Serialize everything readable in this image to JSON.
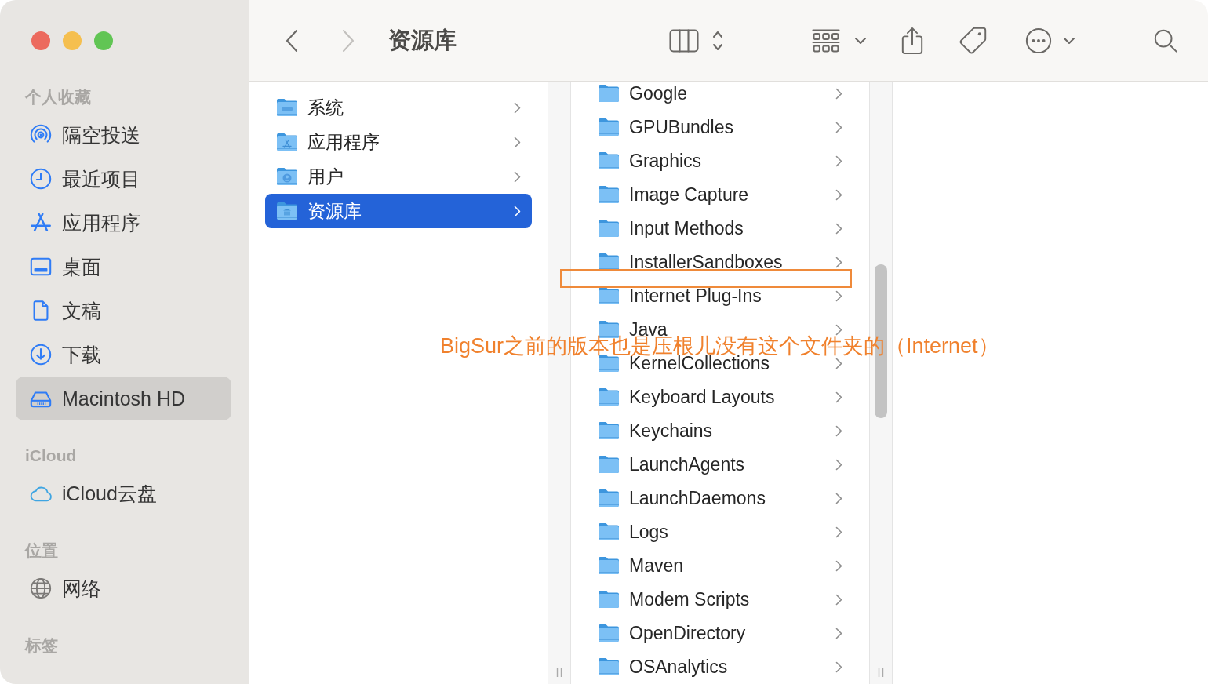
{
  "window": {
    "title": "资源库"
  },
  "toolbar": {
    "back": {
      "disabled": false
    },
    "forward": {
      "disabled": true
    }
  },
  "sidebar": {
    "sections": [
      {
        "heading": "个人收藏",
        "items": [
          {
            "label": "隔空投送",
            "kind": "airdrop",
            "selected": false
          },
          {
            "label": "最近项目",
            "kind": "recents",
            "selected": false
          },
          {
            "label": "应用程序",
            "kind": "applications",
            "selected": false
          },
          {
            "label": "桌面",
            "kind": "desktop",
            "selected": false
          },
          {
            "label": "文稿",
            "kind": "documents",
            "selected": false
          },
          {
            "label": "下载",
            "kind": "downloads",
            "selected": false
          },
          {
            "label": "Macintosh HD",
            "kind": "disk",
            "selected": true
          }
        ]
      },
      {
        "heading": "iCloud",
        "items": [
          {
            "label": "iCloud云盘",
            "kind": "cloud",
            "selected": false
          }
        ]
      },
      {
        "heading": "位置",
        "items": [
          {
            "label": "网络",
            "kind": "network",
            "selected": false
          }
        ]
      },
      {
        "heading": "标签"
      }
    ]
  },
  "columns": [
    {
      "items": [
        {
          "label": "系统",
          "kind": "system",
          "selected": false
        },
        {
          "label": "应用程序",
          "kind": "applications",
          "selected": false
        },
        {
          "label": "用户",
          "kind": "user",
          "selected": false
        },
        {
          "label": "资源库",
          "kind": "library",
          "selected": true
        }
      ]
    },
    {
      "items": [
        {
          "label": "Google",
          "selected": false
        },
        {
          "label": "GPUBundles",
          "selected": false
        },
        {
          "label": "Graphics",
          "selected": false
        },
        {
          "label": "Image Capture",
          "selected": false
        },
        {
          "label": "Input Methods",
          "selected": false
        },
        {
          "label": "InstallerSandboxes",
          "selected": false
        },
        {
          "label": "Internet Plug-Ins",
          "selected": false
        },
        {
          "label": "Java",
          "selected": false
        },
        {
          "label": "KernelCollections",
          "selected": false
        },
        {
          "label": "Keyboard Layouts",
          "selected": false
        },
        {
          "label": "Keychains",
          "selected": false
        },
        {
          "label": "LaunchAgents",
          "selected": false
        },
        {
          "label": "LaunchDaemons",
          "selected": false
        },
        {
          "label": "Logs",
          "selected": false
        },
        {
          "label": "Maven",
          "selected": false
        },
        {
          "label": "Modem Scripts",
          "selected": false
        },
        {
          "label": "OpenDirectory",
          "selected": false
        },
        {
          "label": "OSAnalytics",
          "selected": false
        }
      ]
    }
  ],
  "annotation": {
    "text": "BigSur之前的版本也是压根儿没有这个文件夹的（Internet）"
  }
}
